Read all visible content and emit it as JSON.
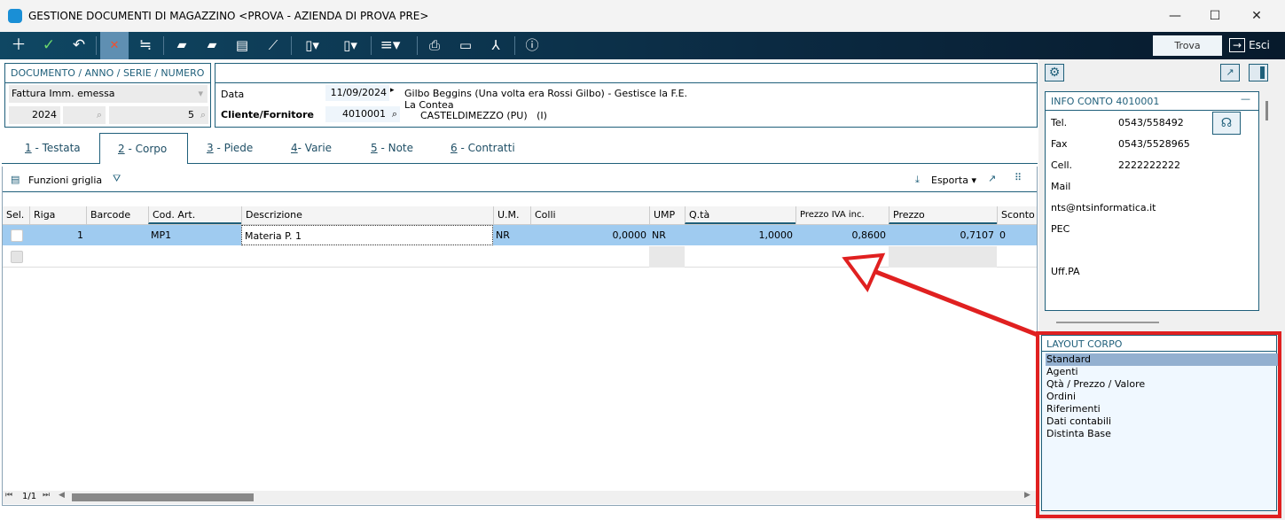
{
  "window": {
    "title": "GESTIONE DOCUMENTI DI MAGAZZINO <PROVA - AZIENDA DI PROVA PRE>",
    "minimize": "—",
    "maximize": "☐",
    "close": "✕"
  },
  "toolbar": {
    "search_label": "Trova (Alt+F1)",
    "exit_label": "Esci"
  },
  "document": {
    "section_title": "DOCUMENTO / ANNO / SERIE / NUMERO",
    "type": "Fattura Imm. emessa",
    "year": "2024",
    "series": "",
    "number": "5"
  },
  "header": {
    "date_label": "Data",
    "date": "11/09/2024",
    "client_label": "Cliente/Fornitore",
    "client_code": "4010001",
    "client_name": "Gilbo Beggins (Una volta era Rossi Gilbo) - Gestisce la F.E.",
    "client_address": "La Contea",
    "client_city": "CASTELDIMEZZO (PU)   (I)"
  },
  "tabs": [
    {
      "num": "1",
      "label": " - Testata"
    },
    {
      "num": "2",
      "label": " - Corpo"
    },
    {
      "num": "3",
      "label": " - Piede"
    },
    {
      "num": "4",
      "label": "- Varie"
    },
    {
      "num": "5",
      "label": " - Note"
    },
    {
      "num": "6",
      "label": " - Contratti"
    }
  ],
  "grid": {
    "functions_label": "Funzioni griglia",
    "export_label": "Esporta",
    "pager": "1/1",
    "columns": [
      "Sel.",
      "Riga",
      "Barcode",
      "Cod. Art.",
      "Descrizione",
      "U.M.",
      "Colli",
      "UMP",
      "Q.tà",
      "Prezzo IVA inc.",
      "Prezzo",
      "Sconto"
    ],
    "rows": [
      {
        "riga": "1",
        "barcode": "",
        "cod": "MP1",
        "descr": "Materia P. 1",
        "um": "NR",
        "colli": "0,0000",
        "ump": "NR",
        "qta": "1,0000",
        "prezzo_iva": "0,8600",
        "prezzo": "0,7107",
        "sconto": "0"
      }
    ]
  },
  "info": {
    "title": "INFO CONTO 4010001",
    "collapse": "—",
    "rows": [
      {
        "label": "Tel.",
        "value": "0543/558492"
      },
      {
        "label": "Fax",
        "value": "0543/5528965"
      },
      {
        "label": "Cell.",
        "value": "2222222222"
      },
      {
        "label": "Mail",
        "value": ""
      },
      {
        "label": "",
        "value": "nts@ntsinformatica.it"
      },
      {
        "label": "PEC",
        "value": ""
      },
      {
        "label": "Uff.PA",
        "value": ""
      }
    ]
  },
  "layout": {
    "title": "LAYOUT CORPO",
    "items": [
      "Standard",
      "Agenti",
      "Qtà / Prezzo / Valore",
      "Ordini",
      "Riferimenti",
      "Dati contabili",
      "Distinta Base"
    ],
    "selected": "Standard"
  },
  "colors": {
    "accent": "#1f5f7a",
    "selected_row": "#9fcbf0",
    "highlight": "#e02020"
  }
}
